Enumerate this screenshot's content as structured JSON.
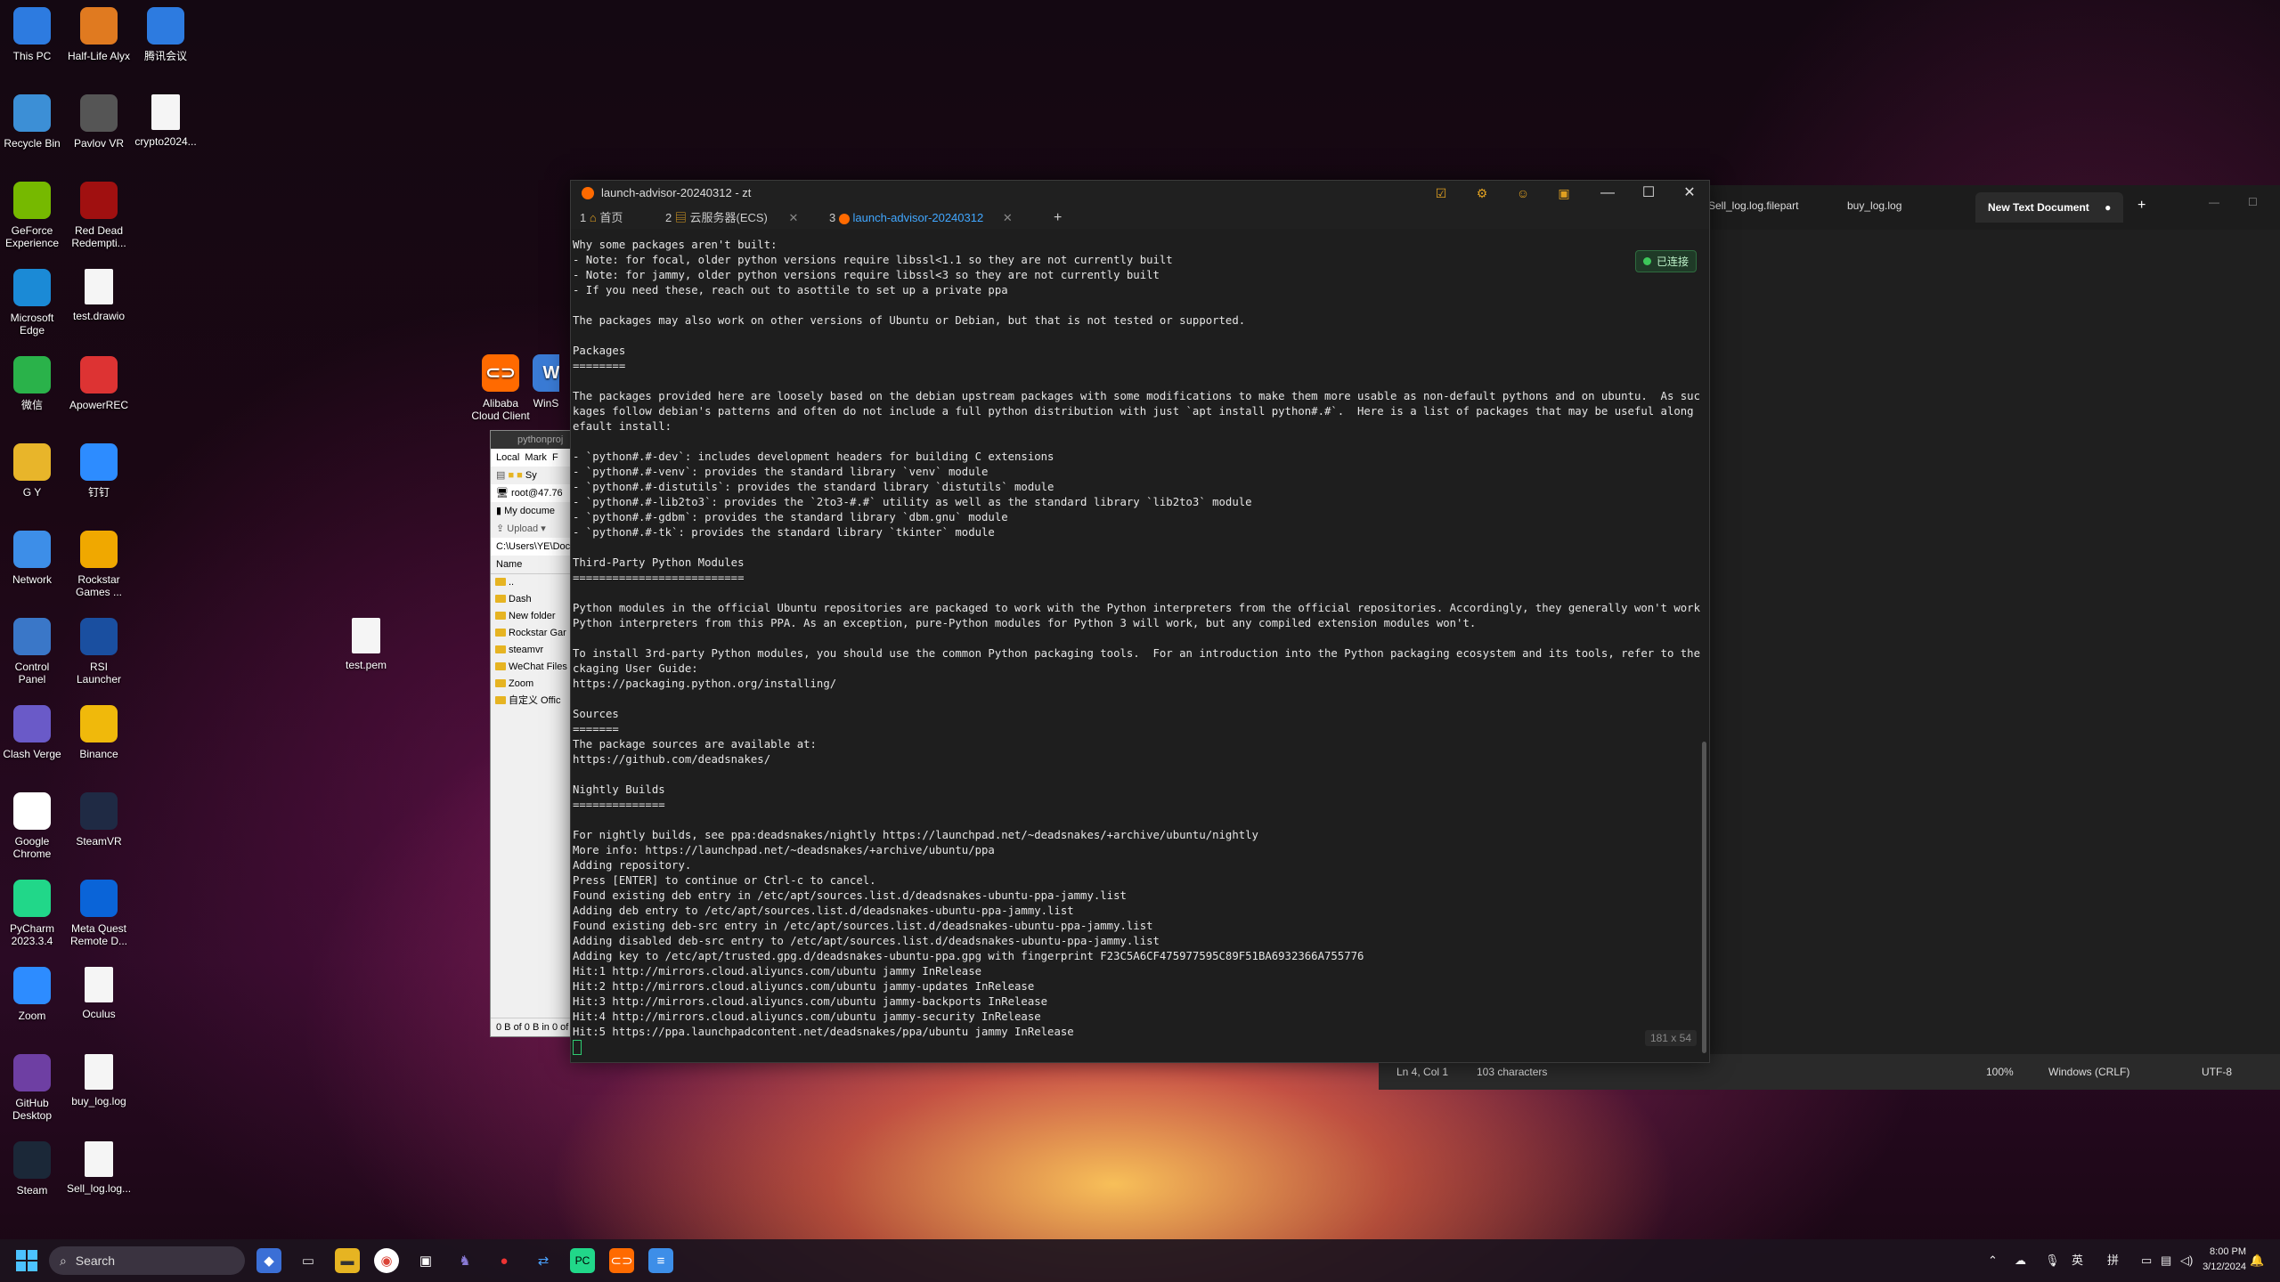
{
  "desktop": {
    "icons_col1": [
      "This PC",
      "Recycle Bin",
      "GeForce Experience",
      "Microsoft Edge",
      "微信",
      "G Y",
      "Network",
      "Control Panel",
      "Clash Verge",
      "Google Chrome",
      "PyCharm 2023.3.4",
      "Zoom",
      "GitHub Desktop",
      "Steam"
    ],
    "icons_col2": [
      "Half-Life Alyx",
      "Pavlov VR",
      "Red Dead Redempti...",
      "test.drawio",
      "ApowerREC",
      "钉钉",
      "Rockstar Games ...",
      "RSI Launcher",
      "Binance",
      "SteamVR",
      "Meta Quest Remote D...",
      "Oculus",
      "buy_log.log",
      "Sell_log.log..."
    ],
    "icons_col3": [
      "腾讯会议",
      "crypto2024..."
    ],
    "extra": {
      "alibaba": "Alibaba Cloud Client",
      "winscp": "WinS",
      "test_pem": "test.pem"
    }
  },
  "notepad": {
    "tabs": [
      "Sell_log.log.filepart",
      "buy_log.log",
      "New Text Document"
    ],
    "active_tab": "New Text Document",
    "status": {
      "position": "Ln 4, Col 1",
      "chars": "103 characters",
      "zoom": "100%",
      "line_ending": "Windows (CRLF)",
      "encoding": "UTF-8"
    }
  },
  "file_manager": {
    "title": "pythonproj",
    "toolbar": [
      "Local",
      "Mark",
      "F"
    ],
    "session": "root@47.76",
    "location": "My docume",
    "upload": "Upload",
    "path": "C:\\Users\\YE\\Doc",
    "col_name": "Name",
    "items": [
      "..",
      "Dash",
      "New folder",
      "Rockstar Gar",
      "steamvr",
      "WeChat Files",
      "Zoom",
      "自定义 Offic"
    ],
    "status": "0 B of 0 B in 0 of"
  },
  "terminal": {
    "title": "launch-advisor-20240312 - zt",
    "tabs": [
      {
        "num": "1",
        "label": "首页"
      },
      {
        "num": "2",
        "label": "云服务器(ECS)"
      },
      {
        "num": "3",
        "label": "launch-advisor-20240312"
      }
    ],
    "connected": "已连接",
    "size": "181 x 54",
    "output": [
      "Why some packages aren't built:",
      "- Note: for focal, older python versions require libssl<1.1 so they are not currently built",
      "- Note: for jammy, older python versions require libssl<3 so they are not currently built",
      "- If you need these, reach out to asottile to set up a private ppa",
      "",
      "The packages may also work on other versions of Ubuntu or Debian, but that is not tested or supported.",
      "",
      "Packages",
      "========",
      "",
      "The packages provided here are loosely based on the debian upstream packages with some modifications to make them more usable as non-default pythons and on ubuntu.  As such, the pac",
      "kages follow debian's patterns and often do not include a full python distribution with just `apt install python#.#`.  Here is a list of packages that may be useful along with the d",
      "efault install:",
      "",
      "- `python#.#-dev`: includes development headers for building C extensions",
      "- `python#.#-venv`: provides the standard library `venv` module",
      "- `python#.#-distutils`: provides the standard library `distutils` module",
      "- `python#.#-lib2to3`: provides the `2to3-#.#` utility as well as the standard library `lib2to3` module",
      "- `python#.#-gdbm`: provides the standard library `dbm.gnu` module",
      "- `python#.#-tk`: provides the standard library `tkinter` module",
      "",
      "Third-Party Python Modules",
      "==========================",
      "",
      "Python modules in the official Ubuntu repositories are packaged to work with the Python interpreters from the official repositories. Accordingly, they generally won't work with the",
      "Python interpreters from this PPA. As an exception, pure-Python modules for Python 3 will work, but any compiled extension modules won't.",
      "",
      "To install 3rd-party Python modules, you should use the common Python packaging tools.  For an introduction into the Python packaging ecosystem and its tools, refer to the Python Pa",
      "ckaging User Guide:",
      "https://packaging.python.org/installing/",
      "",
      "Sources",
      "=======",
      "The package sources are available at:",
      "https://github.com/deadsnakes/",
      "",
      "Nightly Builds",
      "==============",
      "",
      "For nightly builds, see ppa:deadsnakes/nightly https://launchpad.net/~deadsnakes/+archive/ubuntu/nightly",
      "More info: https://launchpad.net/~deadsnakes/+archive/ubuntu/ppa",
      "Adding repository.",
      "Press [ENTER] to continue or Ctrl-c to cancel.",
      "Found existing deb entry in /etc/apt/sources.list.d/deadsnakes-ubuntu-ppa-jammy.list",
      "Adding deb entry to /etc/apt/sources.list.d/deadsnakes-ubuntu-ppa-jammy.list",
      "Found existing deb-src entry in /etc/apt/sources.list.d/deadsnakes-ubuntu-ppa-jammy.list",
      "Adding disabled deb-src entry to /etc/apt/sources.list.d/deadsnakes-ubuntu-ppa-jammy.list",
      "Adding key to /etc/apt/trusted.gpg.d/deadsnakes-ubuntu-ppa.gpg with fingerprint F23C5A6CF475977595C89F51BA6932366A755776",
      "Hit:1 http://mirrors.cloud.aliyuncs.com/ubuntu jammy InRelease",
      "Hit:2 http://mirrors.cloud.aliyuncs.com/ubuntu jammy-updates InRelease",
      "Hit:3 http://mirrors.cloud.aliyuncs.com/ubuntu jammy-backports InRelease",
      "Hit:4 http://mirrors.cloud.aliyuncs.com/ubuntu jammy-security InRelease",
      "Hit:5 https://ppa.launchpadcontent.net/deadsnakes/ppa/ubuntu jammy InRelease"
    ]
  },
  "taskbar": {
    "search_placeholder": "Search",
    "ime": "英",
    "ime2": "拼",
    "time": "8:00 PM",
    "date": "3/12/2024"
  },
  "colors": {
    "accent": "#41a7ff",
    "connected": "#3dc75a"
  }
}
